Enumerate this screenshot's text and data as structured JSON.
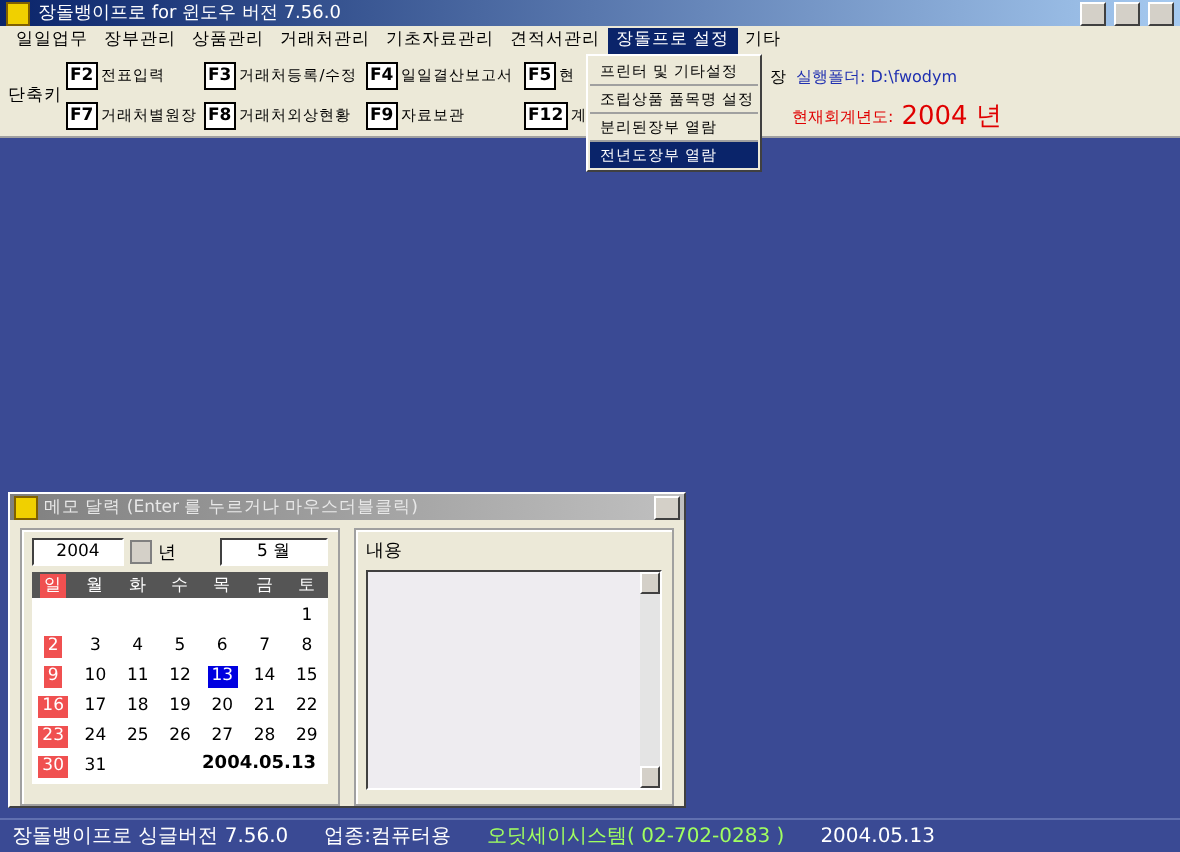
{
  "window": {
    "title": "장돌뱅이프로 for 윈도우 버전 7.56.0"
  },
  "menu": [
    {
      "label": "일일업무",
      "selected": false
    },
    {
      "label": "장부관리",
      "selected": false
    },
    {
      "label": "상품관리",
      "selected": false
    },
    {
      "label": "거래처관리",
      "selected": false
    },
    {
      "label": "기초자료관리",
      "selected": false
    },
    {
      "label": "견적서관리",
      "selected": false
    },
    {
      "label": "장돌프로 설정",
      "selected": true
    },
    {
      "label": "기타",
      "selected": false
    }
  ],
  "dropdown": [
    {
      "label": "프린터 및 기타설정",
      "selected": false
    },
    {
      "label": "조립상품 품목명 설정",
      "selected": false
    },
    {
      "label": "분리된장부 열람",
      "selected": false
    },
    {
      "label": "전년도장부 열람",
      "selected": true
    }
  ],
  "shortcuts": {
    "label": "단축키",
    "row_1": [
      {
        "key": "F2",
        "label": "전표입력"
      },
      {
        "key": "F3",
        "label": "거래처등록/수정"
      },
      {
        "key": "F4",
        "label": "일일결산보고서"
      },
      {
        "key": "F5",
        "label": "현"
      }
    ],
    "row_1_tail": "장",
    "folder": "실행폴더: D:\\fwodym",
    "row_2": [
      {
        "key": "F7",
        "label": "거래처별원장"
      },
      {
        "key": "F8",
        "label": "거래처외상현황"
      },
      {
        "key": "F9",
        "label": "자료보관"
      },
      {
        "key": "F12",
        "label": "계"
      }
    ],
    "fiscal_label": "현재회계년도:",
    "fiscal_year": "2004",
    "fiscal_unit": "년"
  },
  "memo": {
    "title": "메모 달력 (Enter 를 누르거나 마우스더블클릭)",
    "year": "2004",
    "year_unit": "년",
    "month": "5 월",
    "weekdays": [
      {
        "label": "일",
        "holiday": true
      },
      {
        "label": "월",
        "holiday": false
      },
      {
        "label": "화",
        "holiday": false
      },
      {
        "label": "수",
        "holiday": false
      },
      {
        "label": "목",
        "holiday": false
      },
      {
        "label": "금",
        "holiday": false
      },
      {
        "label": "토",
        "holiday": false
      }
    ],
    "weeks": [
      {
        "days": [
          {
            "day": "1",
            "holiday": false,
            "selected": false
          }
        ]
      },
      {
        "days": [
          {
            "day": "2",
            "holiday": true,
            "selected": false
          },
          {
            "day": "3",
            "holiday": false,
            "selected": false
          },
          {
            "day": "4",
            "holiday": false,
            "selected": false
          },
          {
            "day": "5",
            "holiday": false,
            "selected": false
          },
          {
            "day": "6",
            "holiday": false,
            "selected": false
          },
          {
            "day": "7",
            "holiday": false,
            "selected": false
          },
          {
            "day": "8",
            "holiday": false,
            "selected": false
          }
        ]
      },
      {
        "days": [
          {
            "day": "9",
            "holiday": true,
            "selected": false
          },
          {
            "day": "10",
            "holiday": false,
            "selected": false
          },
          {
            "day": "11",
            "holiday": false,
            "selected": false
          },
          {
            "day": "12",
            "holiday": false,
            "selected": false
          },
          {
            "day": "13",
            "holiday": false,
            "selected": true
          },
          {
            "day": "14",
            "holiday": false,
            "selected": false
          },
          {
            "day": "15",
            "holiday": false,
            "selected": false
          }
        ]
      },
      {
        "days": [
          {
            "day": "16",
            "holiday": true,
            "selected": false
          },
          {
            "day": "17",
            "holiday": false,
            "selected": false
          },
          {
            "day": "18",
            "holiday": false,
            "selected": false
          },
          {
            "day": "19",
            "holiday": false,
            "selected": false
          },
          {
            "day": "20",
            "holiday": false,
            "selected": false
          },
          {
            "day": "21",
            "holiday": false,
            "selected": false
          },
          {
            "day": "22",
            "holiday": false,
            "selected": false
          }
        ]
      },
      {
        "days": [
          {
            "day": "23",
            "holiday": true,
            "selected": false
          },
          {
            "day": "24",
            "holiday": false,
            "selected": false
          },
          {
            "day": "25",
            "holiday": false,
            "selected": false
          },
          {
            "day": "26",
            "holiday": false,
            "selected": false
          },
          {
            "day": "27",
            "holiday": false,
            "selected": false
          },
          {
            "day": "28",
            "holiday": false,
            "selected": false
          },
          {
            "day": "29",
            "holiday": false,
            "selected": false
          }
        ]
      },
      {
        "days": [
          {
            "day": "30",
            "holiday": true,
            "selected": false
          },
          {
            "day": "31",
            "holiday": false,
            "selected": false
          }
        ]
      }
    ],
    "selected_date": "2004.05.13",
    "content_label": "내용"
  },
  "status_bar": {
    "version": "장돌뱅이프로 싱글버전 7.56.0",
    "business": "업종:컴퓨터용",
    "company": "오딧세이시스템( 02-702-0283 )",
    "date": "2004.05.13"
  }
}
